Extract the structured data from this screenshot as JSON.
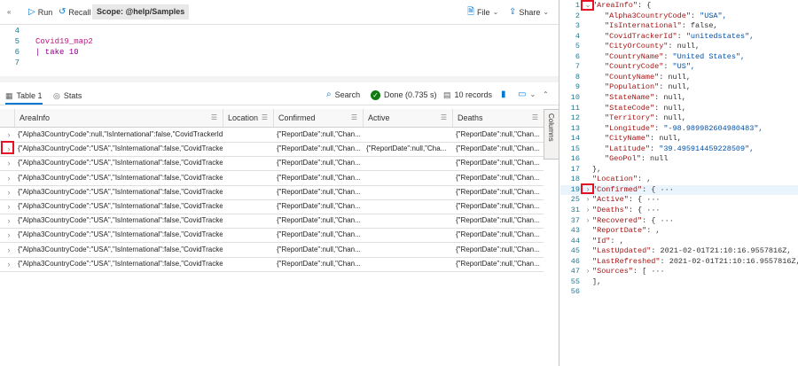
{
  "toolbar": {
    "run": "Run",
    "recall": "Recall",
    "scope": "Scope: @help/Samples",
    "file": "File",
    "share": "Share"
  },
  "editor": {
    "lines": [
      {
        "num": "4",
        "text": ""
      },
      {
        "num": "5",
        "text": "Covid19_map2"
      },
      {
        "num": "6",
        "text": "| take 10"
      },
      {
        "num": "7",
        "text": ""
      }
    ]
  },
  "results": {
    "tab_table": "Table 1",
    "tab_stats": "Stats",
    "search": "Search",
    "done": "Done (0.735 s)",
    "records": "10 records"
  },
  "grid": {
    "columns": [
      "AreaInfo",
      "Location",
      "Confirmed",
      "Active",
      "Deaths"
    ],
    "columns_panel": "Columns",
    "rows": [
      [
        "{\"Alpha3CountryCode\":null,\"IsInternational\":false,\"CovidTrackerId\":...",
        "",
        "{\"ReportDate\":null,\"Chan...",
        "",
        "{\"ReportDate\":null,\"Chan..."
      ],
      [
        "{\"Alpha3CountryCode\":\"USA\",\"IsInternational\":false,\"CovidTrackerI...",
        "",
        "{\"ReportDate\":null,\"Chan...",
        "{\"ReportDate\":null,\"Cha...",
        "{\"ReportDate\":null,\"Chan..."
      ],
      [
        "{\"Alpha3CountryCode\":\"USA\",\"IsInternational\":false,\"CovidTrackerI...",
        "",
        "{\"ReportDate\":null,\"Chan...",
        "",
        "{\"ReportDate\":null,\"Chan..."
      ],
      [
        "{\"Alpha3CountryCode\":\"USA\",\"IsInternational\":false,\"CovidTrackerI...",
        "",
        "{\"ReportDate\":null,\"Chan...",
        "",
        "{\"ReportDate\":null,\"Chan..."
      ],
      [
        "{\"Alpha3CountryCode\":\"USA\",\"IsInternational\":false,\"CovidTrackerI...",
        "",
        "{\"ReportDate\":null,\"Chan...",
        "",
        "{\"ReportDate\":null,\"Chan..."
      ],
      [
        "{\"Alpha3CountryCode\":\"USA\",\"IsInternational\":false,\"CovidTrackerI...",
        "",
        "{\"ReportDate\":null,\"Chan...",
        "",
        "{\"ReportDate\":null,\"Chan..."
      ],
      [
        "{\"Alpha3CountryCode\":\"USA\",\"IsInternational\":false,\"CovidTrackerI...",
        "",
        "{\"ReportDate\":null,\"Chan...",
        "",
        "{\"ReportDate\":null,\"Chan..."
      ],
      [
        "{\"Alpha3CountryCode\":\"USA\",\"IsInternational\":false,\"CovidTrackerI...",
        "",
        "{\"ReportDate\":null,\"Chan...",
        "",
        "{\"ReportDate\":null,\"Chan..."
      ],
      [
        "{\"Alpha3CountryCode\":\"USA\",\"IsInternational\":false,\"CovidTrackerI...",
        "",
        "{\"ReportDate\":null,\"Chan...",
        "",
        "{\"ReportDate\":null,\"Chan..."
      ],
      [
        "{\"Alpha3CountryCode\":\"USA\",\"IsInternational\":false,\"CovidTrackerI...",
        "",
        "{\"ReportDate\":null,\"Chan...",
        "",
        "{\"ReportDate\":null,\"Chan..."
      ]
    ]
  },
  "json_view": {
    "lines": [
      {
        "num": "1",
        "fold": "v",
        "key": "\"AreaInfo\"",
        "sep": ": ",
        "val": "{",
        "indent": 0
      },
      {
        "num": "2",
        "fold": "",
        "key": "\"Alpha3CountryCode\"",
        "sep": ": ",
        "val": "\"USA\",",
        "indent": 1
      },
      {
        "num": "3",
        "fold": "",
        "key": "\"IsInternational\"",
        "sep": ": ",
        "val": "false,",
        "indent": 1
      },
      {
        "num": "4",
        "fold": "",
        "key": "\"CovidTrackerId\"",
        "sep": ": ",
        "val": "\"unitedstates\",",
        "indent": 1
      },
      {
        "num": "5",
        "fold": "",
        "key": "\"CityOrCounty\"",
        "sep": ": ",
        "val": "null,",
        "indent": 1
      },
      {
        "num": "6",
        "fold": "",
        "key": "\"CountryName\"",
        "sep": ": ",
        "val": "\"United States\",",
        "indent": 1
      },
      {
        "num": "7",
        "fold": "",
        "key": "\"CountryCode\"",
        "sep": ": ",
        "val": "\"US\",",
        "indent": 1
      },
      {
        "num": "8",
        "fold": "",
        "key": "\"CountyName\"",
        "sep": ": ",
        "val": "null,",
        "indent": 1
      },
      {
        "num": "9",
        "fold": "",
        "key": "\"Population\"",
        "sep": ": ",
        "val": "null,",
        "indent": 1
      },
      {
        "num": "10",
        "fold": "",
        "key": "\"StateName\"",
        "sep": ": ",
        "val": "null,",
        "indent": 1
      },
      {
        "num": "11",
        "fold": "",
        "key": "\"StateCode\"",
        "sep": ": ",
        "val": "null,",
        "indent": 1
      },
      {
        "num": "12",
        "fold": "",
        "key": "\"Territory\"",
        "sep": ": ",
        "val": "null,",
        "indent": 1
      },
      {
        "num": "13",
        "fold": "",
        "key": "\"Longitude\"",
        "sep": ": ",
        "val": "\"-98.989982604980483\",",
        "indent": 1
      },
      {
        "num": "14",
        "fold": "",
        "key": "\"CityName\"",
        "sep": ": ",
        "val": "null,",
        "indent": 1
      },
      {
        "num": "15",
        "fold": "",
        "key": "\"Latitude\"",
        "sep": ": ",
        "val": "\"39.495914459228509\",",
        "indent": 1
      },
      {
        "num": "16",
        "fold": "",
        "key": "\"GeoPol\"",
        "sep": ": ",
        "val": "null",
        "indent": 1
      },
      {
        "num": "17",
        "fold": "",
        "key": "",
        "sep": "",
        "val": "},",
        "indent": 0
      },
      {
        "num": "18",
        "fold": "",
        "key": "\"Location\"",
        "sep": ": ",
        "val": ",",
        "indent": 0
      },
      {
        "num": "19",
        "fold": ">",
        "key": "\"Confirmed\"",
        "sep": ": ",
        "val": "{ ···",
        "indent": 0,
        "hl": true
      },
      {
        "num": "25",
        "fold": ">",
        "key": "\"Active\"",
        "sep": ": ",
        "val": "{ ···",
        "indent": 0
      },
      {
        "num": "31",
        "fold": ">",
        "key": "\"Deaths\"",
        "sep": ": ",
        "val": "{ ···",
        "indent": 0
      },
      {
        "num": "37",
        "fold": ">",
        "key": "\"Recovered\"",
        "sep": ": ",
        "val": "{ ···",
        "indent": 0
      },
      {
        "num": "43",
        "fold": "",
        "key": "\"ReportDate\"",
        "sep": ": ",
        "val": ",",
        "indent": 0
      },
      {
        "num": "44",
        "fold": "",
        "key": "\"Id\"",
        "sep": ": ",
        "val": ",",
        "indent": 0
      },
      {
        "num": "45",
        "fold": "",
        "key": "\"LastUpdated\"",
        "sep": ": ",
        "val": "2021-02-01T21:10:16.9557816Z,",
        "indent": 0
      },
      {
        "num": "46",
        "fold": "",
        "key": "\"LastRefreshed\"",
        "sep": ": ",
        "val": "2021-02-01T21:10:16.9557816Z,",
        "indent": 0
      },
      {
        "num": "47",
        "fold": ">",
        "key": "\"Sources\"",
        "sep": ": ",
        "val": "[ ···",
        "indent": 0
      },
      {
        "num": "55",
        "fold": "",
        "key": "",
        "sep": "",
        "val": "],",
        "indent": 0
      },
      {
        "num": "56",
        "fold": "",
        "key": "",
        "sep": "",
        "val": "",
        "indent": 0
      }
    ]
  },
  "colors": {
    "accent": "#0078d4",
    "success": "#107c10",
    "highlight_box": "#e81123"
  }
}
